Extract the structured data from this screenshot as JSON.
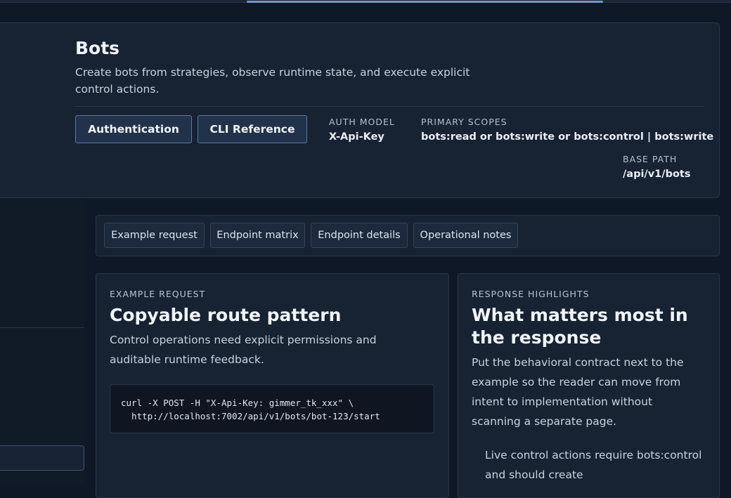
{
  "hero": {
    "title": "Bots",
    "description": "Create bots from strategies, observe runtime state, and execute explicit control actions.",
    "buttons": {
      "authentication": "Authentication",
      "cli_reference": "CLI Reference"
    },
    "meta": {
      "auth_model_label": "AUTH MODEL",
      "auth_model_value": "X-Api-Key",
      "primary_scopes_label": "PRIMARY SCOPES",
      "primary_scopes_value": "bots:read or bots:write or bots:control | bots:write",
      "base_path_label": "BASE PATH",
      "base_path_value": "/api/v1/bots"
    }
  },
  "tabs": [
    {
      "label": "Example request"
    },
    {
      "label": "Endpoint matrix"
    },
    {
      "label": "Endpoint details"
    },
    {
      "label": "Operational notes"
    }
  ],
  "example_card": {
    "eyebrow": "EXAMPLE REQUEST",
    "title": "Copyable route pattern",
    "description": "Control operations need explicit permissions and auditable runtime feedback.",
    "code_line_1": "curl -X POST -H \"X-Api-Key: gimmer_tk_xxx\" \\",
    "code_line_2": "  http://localhost:7002/api/v1/bots/bot-123/start"
  },
  "response_card": {
    "eyebrow": "RESPONSE HIGHLIGHTS",
    "title": "What matters most in the response",
    "description": "Put the behavioral contract next to the example so the reader can move from intent to implementation without scanning a separate page.",
    "highlight_1": "Live control actions require bots:control and should create"
  }
}
